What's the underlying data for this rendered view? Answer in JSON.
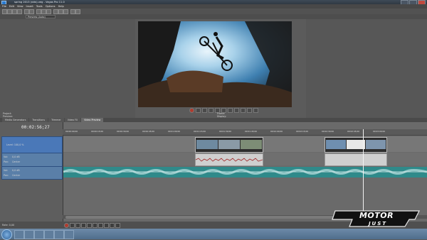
{
  "window": {
    "title": "spring 2013 (vids).veg - Vegas Pro 11.0"
  },
  "menu": [
    "File",
    "Edit",
    "View",
    "Insert",
    "Tools",
    "Options",
    "Help"
  ],
  "preview": {
    "mode": "Preview (Auto)",
    "project": "Project:",
    "preview_label": "Preview:",
    "frame_label": "Frame:",
    "display_label": "Display:"
  },
  "tabs": [
    "Media Generators",
    "Transitions",
    "Trimmer",
    "Video FX",
    "Video Preview"
  ],
  "active_tab": "Video Preview",
  "timeline": {
    "timecode": "00:02:56;27",
    "ruler_ticks": [
      "00:00:00;00",
      "00:00:15;00",
      "00:00:30;00",
      "00:00:45;00",
      "00:01:00;00",
      "00:01:15;00",
      "00:01:30;00",
      "00:01:45;00",
      "00:02:00;00",
      "00:02:15;00",
      "00:02:30;00",
      "00:02:45;00",
      "00:03:00;00"
    ],
    "tracks": [
      {
        "level": "Level: 100,0 %"
      },
      {
        "vol": "Vol:",
        "vol_val": "0,0 dB",
        "pan": "Pan:",
        "pan_val": "Center"
      },
      {
        "vol": "Vol:",
        "vol_val": "0,0 dB",
        "pan": "Pan:",
        "pan_val": "Center"
      }
    ]
  },
  "status": {
    "rate": "Rate: 0,00"
  },
  "logo": {
    "text": "MOTOR JUST"
  },
  "colors": {
    "accent": "#4a78b8",
    "music": "#2f8a8a",
    "record": "#b03b2e"
  }
}
